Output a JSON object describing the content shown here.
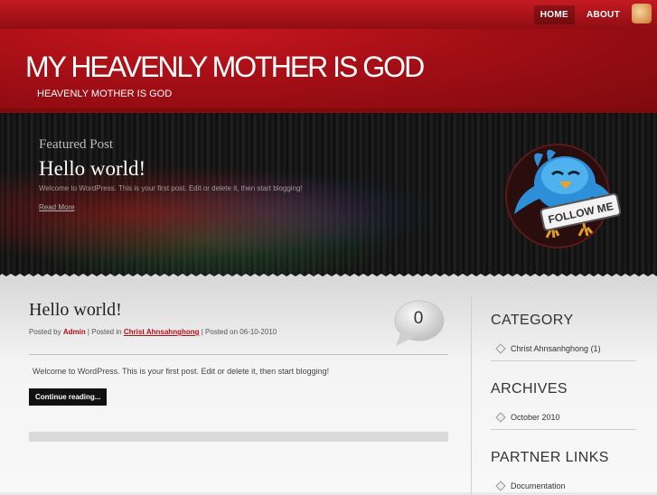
{
  "nav": {
    "items": [
      {
        "label": "HOME"
      },
      {
        "label": "ABOUT"
      }
    ]
  },
  "header": {
    "title": "MY HEAVENLY MOTHER IS GOD",
    "description": "HEAVENLY MOTHER IS GOD"
  },
  "featured": {
    "kicker": "Featured Post",
    "title": "Hello world!",
    "excerpt": "Welcome to WordPress. This is your first post. Edit or delete it, then start blogging!",
    "more": "Read More",
    "badge_text": "FOLLOW ME"
  },
  "post": {
    "title": "Hello world!",
    "meta_prefix": "Posted by ",
    "author": "Admin",
    "meta_mid": " | Posted in ",
    "category": "Christ Ahnsahnghong",
    "meta_suffix": " | Posted on 06-10-2010",
    "comment_count": "0",
    "excerpt": "Welcome to WordPress. This is your first post. Edit or delete it, then start blogging!",
    "continue_label": "Continue reading..."
  },
  "sidebar": {
    "category": {
      "heading": "CATEGORY",
      "items": [
        "Christ Ahnsanhghong (1)"
      ]
    },
    "archives": {
      "heading": "ARCHIVES",
      "items": [
        "October 2010"
      ]
    },
    "partners": {
      "heading": "PARTNER LINKS",
      "items": [
        "Documentation"
      ]
    }
  }
}
